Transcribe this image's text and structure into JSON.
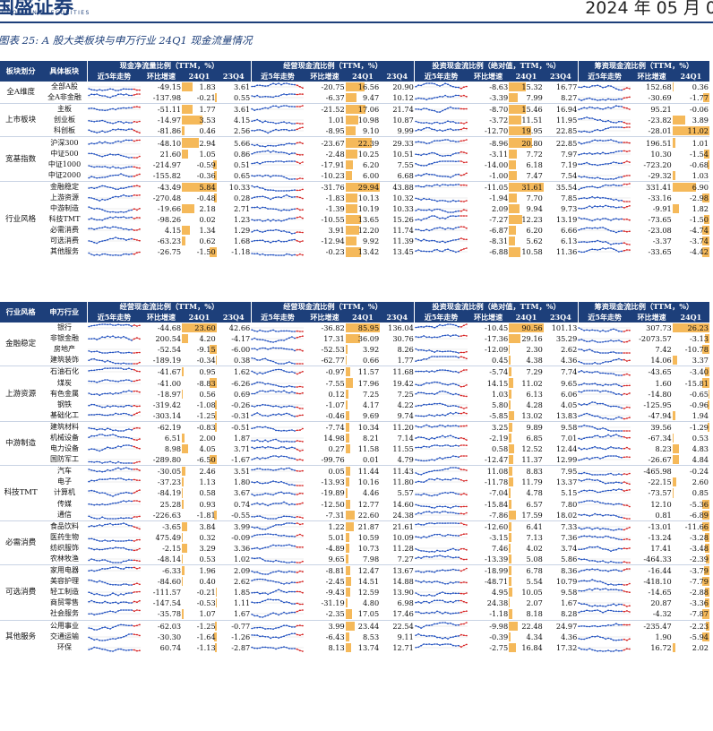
{
  "header": {
    "brand": "国盛证券",
    "brand_en": "GUOSHENG SECURITIES",
    "date": "2024 年 05 月 0"
  },
  "caption": "图表 25:  A 股大类板块与申万行业 24Q1 现金流量情况",
  "table1": {
    "col_group": "板块划分",
    "col_item": "具体板块",
    "sections": [
      "现金净流量比例（TTM，%）",
      "经营现金流比例（TTM，%）",
      "投资现金流比例（绝对值，TTM，%）",
      "筹资现金流比例（TTM，%）"
    ],
    "subheaders": [
      "近5年走势",
      "环比增速",
      "24Q1",
      "23Q4"
    ],
    "groups": [
      {
        "name": "全A维度",
        "rows": [
          {
            "name": "全部A股",
            "v": [
              "-49.15",
              "1.83",
              "3.61",
              "-20.75",
              "16.56",
              "20.90",
              "-8.63",
              "15.32",
              "16.77",
              "152.68",
              "0.36"
            ]
          },
          {
            "name": "全A非金融",
            "v": [
              "-137.98",
              "-0.21",
              "0.55",
              "-6.37",
              "9.47",
              "10.12",
              "-3.39",
              "7.99",
              "8.27",
              "-30.69",
              "-1.77"
            ]
          }
        ]
      },
      {
        "name": "上市板块",
        "rows": [
          {
            "name": "主板",
            "v": [
              "-51.11",
              "1.77",
              "3.61",
              "-21.52",
              "17.06",
              "21.74",
              "-8.70",
              "15.46",
              "16.94",
              "95.21",
              "-0.06"
            ]
          },
          {
            "name": "创业板",
            "v": [
              "-14.97",
              "3.53",
              "4.15",
              "1.01",
              "10.98",
              "10.87",
              "-3.72",
              "11.51",
              "11.95",
              "-23.82",
              "3.89"
            ]
          },
          {
            "name": "科创板",
            "v": [
              "-81.86",
              "0.46",
              "2.56",
              "-8.95",
              "9.10",
              "9.99",
              "-12.70",
              "19.95",
              "22.85",
              "-28.01",
              "11.02"
            ]
          }
        ]
      },
      {
        "name": "宽基指数",
        "rows": [
          {
            "name": "沪深300",
            "v": [
              "-48.10",
              "2.94",
              "5.66",
              "-23.67",
              "22.39",
              "29.33",
              "-8.96",
              "20.80",
              "22.85",
              "196.51",
              "1.01"
            ]
          },
          {
            "name": "中证500",
            "v": [
              "21.60",
              "1.05",
              "0.86",
              "-2.48",
              "10.25",
              "10.51",
              "-3.11",
              "7.72",
              "7.97",
              "10.30",
              "-1.54"
            ]
          },
          {
            "name": "中证1000",
            "v": [
              "-214.97",
              "-0.59",
              "0.51",
              "-17.91",
              "6.20",
              "7.55",
              "-14.00",
              "6.18",
              "7.19",
              "-723.20",
              "-0.68"
            ]
          },
          {
            "name": "中证2000",
            "v": [
              "-155.82",
              "-0.36",
              "0.65",
              "-10.23",
              "6.00",
              "6.68",
              "-1.00",
              "7.47",
              "7.54",
              "-29.32",
              "1.03"
            ]
          }
        ]
      },
      {
        "name": "行业风格",
        "rows": [
          {
            "name": "金融稳定",
            "v": [
              "-43.49",
              "5.84",
              "10.33",
              "-31.76",
              "29.94",
              "43.88",
              "-11.05",
              "31.61",
              "35.54",
              "331.41",
              "6.90"
            ]
          },
          {
            "name": "上游资源",
            "v": [
              "-270.48",
              "-0.48",
              "0.28",
              "-1.83",
              "10.13",
              "10.32",
              "-1.94",
              "7.70",
              "7.85",
              "-33.16",
              "-2.98"
            ]
          },
          {
            "name": "中游制造",
            "v": [
              "-19.66",
              "2.18",
              "2.71",
              "-1.39",
              "10.19",
              "10.33",
              "2.09",
              "9.94",
              "9.73",
              "-9.91",
              "1.82"
            ]
          },
          {
            "name": "科技TMT",
            "v": [
              "-98.26",
              "0.02",
              "1.23",
              "-10.55",
              "13.65",
              "15.26",
              "-7.27",
              "12.23",
              "13.19",
              "-73.65",
              "-1.50"
            ]
          },
          {
            "name": "必需消费",
            "v": [
              "4.15",
              "1.34",
              "1.29",
              "3.91",
              "12.20",
              "11.74",
              "-6.87",
              "6.20",
              "6.66",
              "-23.08",
              "-4.74"
            ]
          },
          {
            "name": "可选消费",
            "v": [
              "-63.23",
              "0.62",
              "1.68",
              "-12.94",
              "9.92",
              "11.39",
              "-8.31",
              "5.62",
              "6.13",
              "-3.37",
              "-3.74"
            ]
          },
          {
            "name": "其他服务",
            "v": [
              "-26.75",
              "-1.50",
              "-1.18",
              "-0.23",
              "13.42",
              "13.45",
              "-6.88",
              "10.58",
              "11.36",
              "-33.65",
              "-4.42"
            ]
          }
        ]
      }
    ]
  },
  "table2": {
    "col_group": "行业风格",
    "col_item": "申万行业",
    "sections": [
      "经营现金流比例（TTM，%）",
      "经营现金流比例（TTM，%）",
      "投资现金流比例（绝对值，TTM，%）",
      "筹资现金流比例（TTM，%）"
    ],
    "subheaders": [
      "近5年走势",
      "环比增速",
      "24Q1",
      "23Q4"
    ],
    "groups": [
      {
        "name": "金融稳定",
        "rows": [
          {
            "name": "银行",
            "v": [
              "-44.68",
              "23.60",
              "42.66",
              "-36.82",
              "85.95",
              "136.04",
              "-10.45",
              "90.56",
              "101.13",
              "307.73",
              "26.23"
            ]
          },
          {
            "name": "非银金融",
            "v": [
              "200.54",
              "4.20",
              "-4.17",
              "17.31",
              "36.09",
              "30.76",
              "-17.36",
              "29.16",
              "35.29",
              "-2073.57",
              "-3.13"
            ]
          },
          {
            "name": "房地产",
            "v": [
              "-52.54",
              "-9.15",
              "-6.00",
              "-52.53",
              "3.92",
              "8.26",
              "-12.09",
              "2.30",
              "2.62",
              "7.42",
              "-10.78"
            ]
          },
          {
            "name": "建筑装饰",
            "v": [
              "-189.19",
              "-0.34",
              "0.38",
              "-62.77",
              "0.66",
              "1.77",
              "0.45",
              "4.38",
              "4.36",
              "14.06",
              "3.37"
            ]
          }
        ]
      },
      {
        "name": "上游资源",
        "rows": [
          {
            "name": "石油石化",
            "v": [
              "-41.67",
              "0.95",
              "1.62",
              "-0.97",
              "11.57",
              "11.68",
              "-5.74",
              "7.29",
              "7.74",
              "-43.65",
              "-3.40"
            ]
          },
          {
            "name": "煤炭",
            "v": [
              "-41.00",
              "-8.83",
              "-6.26",
              "-7.55",
              "17.96",
              "19.42",
              "14.15",
              "11.02",
              "9.65",
              "1.60",
              "-15.81"
            ]
          },
          {
            "name": "有色金属",
            "v": [
              "-18.97",
              "0.56",
              "0.69",
              "0.12",
              "7.25",
              "7.25",
              "1.03",
              "6.13",
              "6.06",
              "-14.80",
              "-0.65"
            ]
          },
          {
            "name": "钢铁",
            "v": [
              "-319.42",
              "-1.08",
              "-0.26",
              "-1.07",
              "4.17",
              "4.22",
              "5.80",
              "4.28",
              "4.05",
              "-125.95",
              "-0.96"
            ]
          },
          {
            "name": "基础化工",
            "v": [
              "-303.14",
              "-1.25",
              "-0.31",
              "-0.46",
              "9.69",
              "9.74",
              "-5.85",
              "13.02",
              "13.83",
              "-47.94",
              "1.94"
            ]
          }
        ]
      },
      {
        "name": "中游制造",
        "rows": [
          {
            "name": "建筑材料",
            "v": [
              "-62.19",
              "-0.83",
              "-0.51",
              "-7.74",
              "10.34",
              "11.20",
              "3.25",
              "9.89",
              "9.58",
              "39.56",
              "-1.29"
            ]
          },
          {
            "name": "机械设备",
            "v": [
              "6.51",
              "2.00",
              "1.87",
              "14.98",
              "8.21",
              "7.14",
              "-2.19",
              "6.85",
              "7.01",
              "-67.34",
              "0.53"
            ]
          },
          {
            "name": "电力设备",
            "v": [
              "8.98",
              "4.05",
              "3.71",
              "0.27",
              "11.58",
              "11.55",
              "0.58",
              "12.52",
              "12.44",
              "8.23",
              "4.83"
            ]
          },
          {
            "name": "国防军工",
            "v": [
              "-289.80",
              "-6.50",
              "-1.67",
              "-99.76",
              "0.01",
              "4.79",
              "-12.47",
              "11.37",
              "12.99",
              "-26.67",
              "4.84"
            ]
          }
        ]
      },
      {
        "name": "科技TMT",
        "rows": [
          {
            "name": "汽车",
            "v": [
              "-30.05",
              "2.46",
              "3.51",
              "0.05",
              "11.44",
              "11.43",
              "11.08",
              "8.83",
              "7.95",
              "-465.98",
              "-0.24"
            ]
          },
          {
            "name": "电子",
            "v": [
              "-37.23",
              "1.13",
              "1.80",
              "-13.93",
              "10.16",
              "11.80",
              "-11.78",
              "11.79",
              "13.37",
              "-22.15",
              "2.60"
            ]
          },
          {
            "name": "计算机",
            "v": [
              "-84.19",
              "0.58",
              "3.67",
              "-19.89",
              "4.46",
              "5.57",
              "-7.04",
              "4.78",
              "5.15",
              "-73.57",
              "0.85"
            ]
          },
          {
            "name": "传媒",
            "v": [
              "25.28",
              "0.93",
              "0.74",
              "-12.50",
              "12.77",
              "14.60",
              "-15.84",
              "6.57",
              "7.80",
              "12.10",
              "-5.36"
            ]
          },
          {
            "name": "通信",
            "v": [
              "-226.63",
              "-1.81",
              "-0.55",
              "-7.31",
              "22.60",
              "24.38",
              "-7.86",
              "17.59",
              "18.02",
              "0.81",
              "-6.89"
            ]
          }
        ]
      },
      {
        "name": "必需消费",
        "rows": [
          {
            "name": "食品饮料",
            "v": [
              "-3.65",
              "3.84",
              "3.99",
              "1.22",
              "21.87",
              "21.61",
              "-12.60",
              "6.41",
              "7.33",
              "-13.01",
              "-11.66"
            ]
          },
          {
            "name": "医药生物",
            "v": [
              "475.49",
              "0.32",
              "-0.09",
              "5.01",
              "10.59",
              "10.09",
              "-3.15",
              "7.13",
              "7.36",
              "-13.24",
              "-3.28"
            ]
          },
          {
            "name": "纺织服饰",
            "v": [
              "-2.15",
              "3.29",
              "3.36",
              "-4.89",
              "10.73",
              "11.28",
              "7.46",
              "4.02",
              "3.74",
              "17.41",
              "-3.48"
            ]
          },
          {
            "name": "农林牧渔",
            "v": [
              "-48.14",
              "0.53",
              "1.02",
              "9.65",
              "7.98",
              "7.27",
              "-13.39",
              "5.08",
              "5.86",
              "-464.33",
              "-2.39"
            ]
          }
        ]
      },
      {
        "name": "可选消费",
        "rows": [
          {
            "name": "家用电器",
            "v": [
              "-6.33",
              "1.96",
              "2.09",
              "-8.81",
              "12.47",
              "13.67",
              "-18.99",
              "6.78",
              "8.36",
              "-16.44",
              "-3.79"
            ]
          },
          {
            "name": "美容护理",
            "v": [
              "-84.60",
              "0.40",
              "2.62",
              "-2.45",
              "14.51",
              "14.88",
              "-48.71",
              "5.54",
              "10.79",
              "-418.10",
              "-7.79"
            ]
          },
          {
            "name": "轻工制造",
            "v": [
              "-111.57",
              "-0.21",
              "1.85",
              "-9.43",
              "12.59",
              "13.90",
              "4.95",
              "10.05",
              "9.58",
              "-14.65",
              "-2.88"
            ]
          },
          {
            "name": "商贸零售",
            "v": [
              "-147.54",
              "-0.53",
              "1.11",
              "-31.19",
              "4.80",
              "6.98",
              "24.38",
              "2.07",
              "1.67",
              "20.87",
              "-3.36"
            ]
          },
          {
            "name": "社会服务",
            "v": [
              "-35.78",
              "1.07",
              "1.67",
              "-2.35",
              "17.05",
              "17.46",
              "-1.18",
              "8.18",
              "8.28",
              "-4.32",
              "-7.87"
            ]
          }
        ]
      },
      {
        "name": "其他服务",
        "rows": [
          {
            "name": "公用事业",
            "v": [
              "-62.03",
              "-1.25",
              "-0.77",
              "3.99",
              "23.44",
              "22.54",
              "-9.98",
              "22.48",
              "24.97",
              "-235.47",
              "-2.23"
            ]
          },
          {
            "name": "交通运输",
            "v": [
              "-30.30",
              "-1.64",
              "-1.26",
              "-6.43",
              "8.53",
              "9.11",
              "-0.39",
              "4.34",
              "4.36",
              "1.90",
              "-5.94"
            ]
          },
          {
            "name": "环保",
            "v": [
              "60.74",
              "-1.13",
              "-2.87",
              "8.13",
              "13.74",
              "12.71",
              "-2.75",
              "16.84",
              "17.32",
              "16.72",
              "2.02"
            ]
          }
        ]
      }
    ]
  },
  "colors": {
    "navy": "#1d3f7a",
    "bar": "#f5b95a",
    "spark": "#1f4fbf",
    "spark_end": "#d62020"
  }
}
